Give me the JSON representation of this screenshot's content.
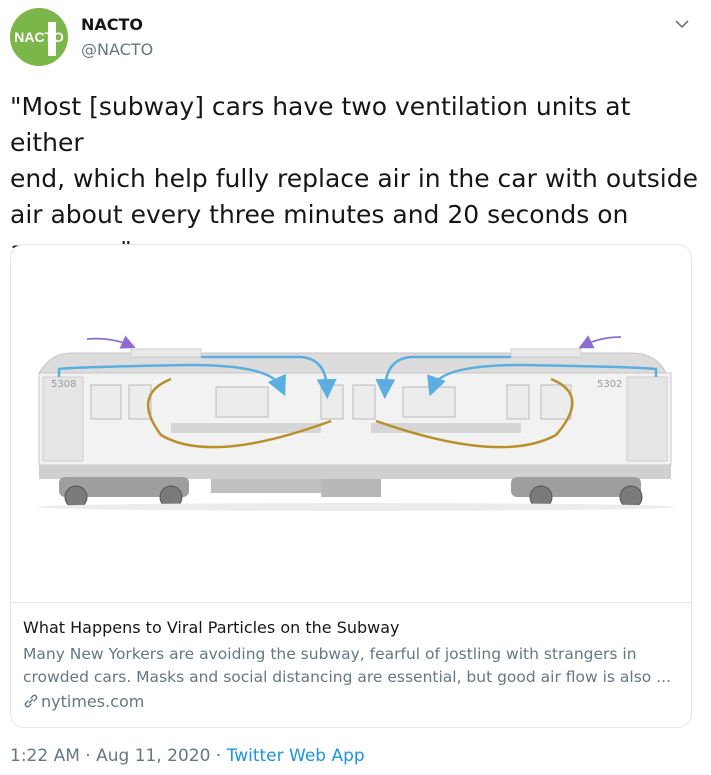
{
  "author": {
    "avatar_text": "NACTO",
    "name": "NACTO",
    "handle": "@NACTO"
  },
  "tweet": {
    "text_lines": [
      "\"Most [subway] cars have two ventilation units at either",
      "end, which help fully replace air in the car with outside",
      "air about every three minutes and 20 seconds on",
      "average.\""
    ]
  },
  "card": {
    "title": "What Happens to Viral Particles on the Subway",
    "description_lines": [
      "Many New Yorkers are avoiding the subway, fearful of jostling with strangers in",
      "crowded cars. Masks and social distancing are essential, but good air flow is also ..."
    ],
    "domain": "nytimes.com",
    "image": {
      "car_number_left": "5308",
      "car_number_right": "5302"
    }
  },
  "meta": {
    "time": "1:22 AM",
    "sep1": " · ",
    "date": "Aug 11, 2020",
    "sep2": " · ",
    "source": "Twitter Web App"
  },
  "colors": {
    "avatar_green": "#7ab648",
    "airflow_blue": "#5aaee0",
    "airflow_gold": "#b8902a",
    "intake_purple": "#8a6fd1",
    "link_blue": "#1b95e0",
    "muted_gray": "#657786"
  }
}
